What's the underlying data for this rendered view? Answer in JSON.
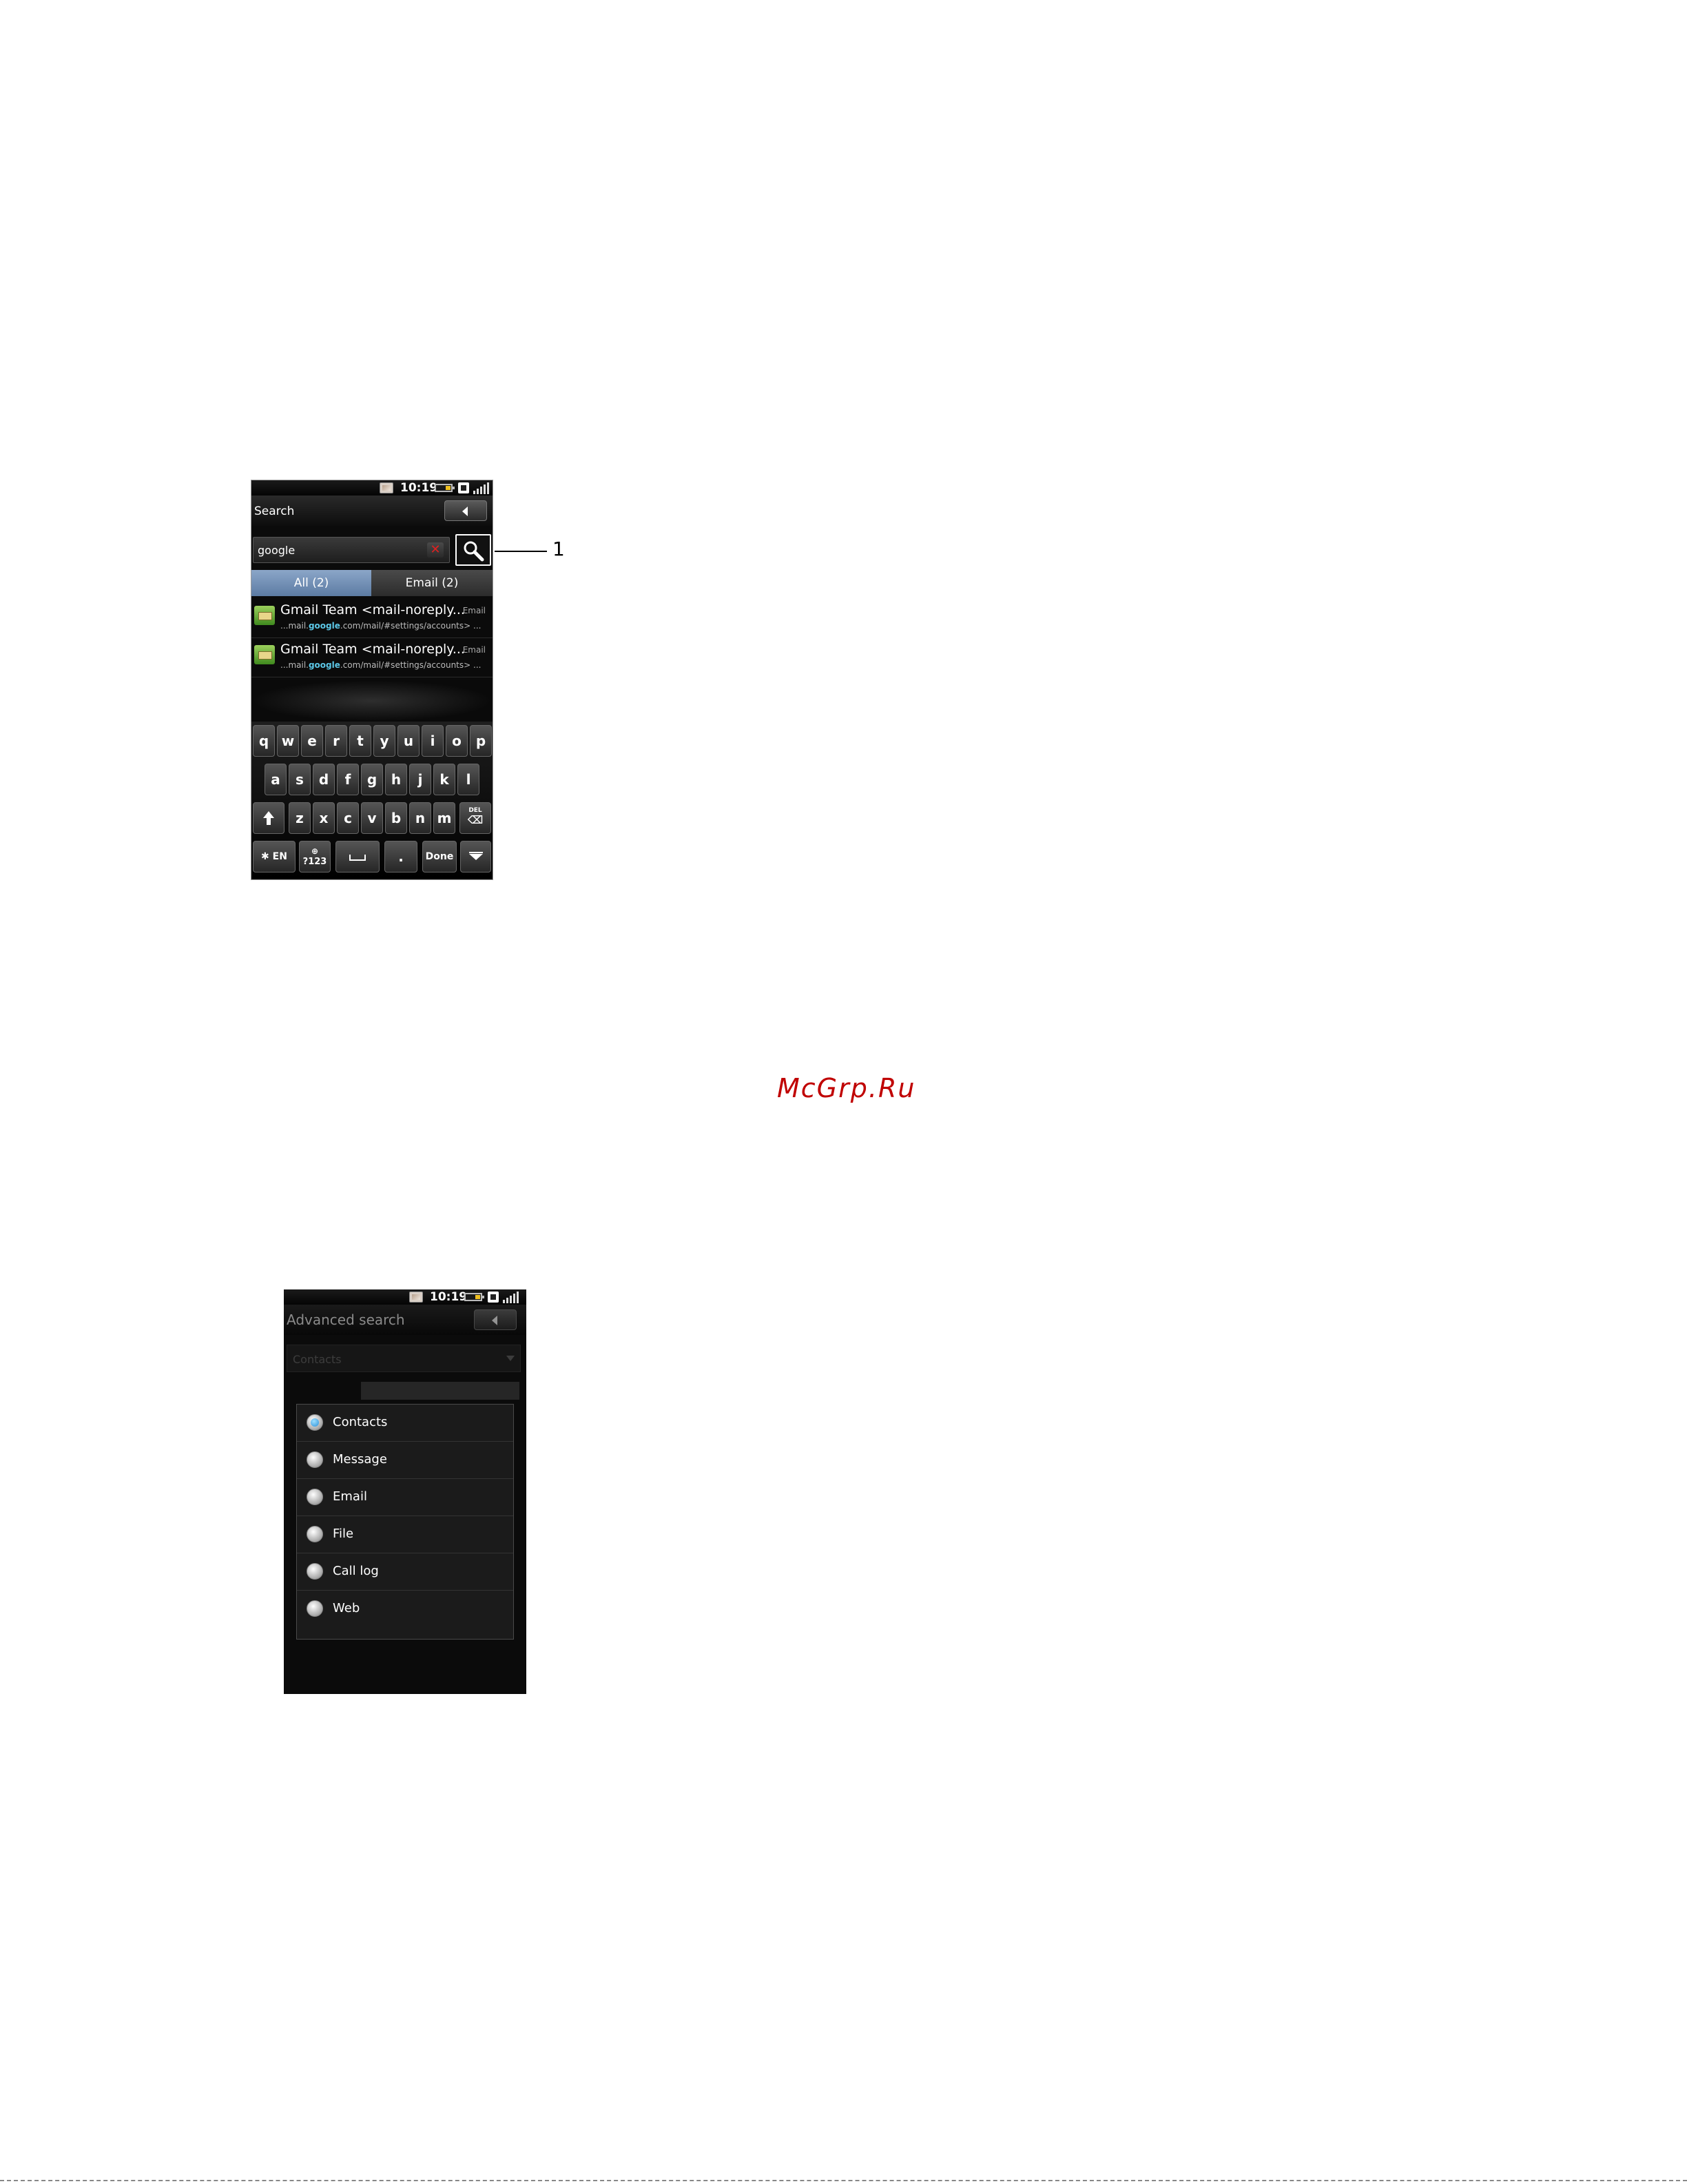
{
  "search_screen": {
    "status_bar": {
      "time": "10:19"
    },
    "title": "Search",
    "search": {
      "query": "google"
    },
    "tabs": [
      {
        "label": "All (2)",
        "active": true
      },
      {
        "label": "Email (2)",
        "active": false
      }
    ],
    "results": [
      {
        "title": "Gmail Team <mail-noreply...",
        "type": "Email",
        "snippet_prefix": "...mail.",
        "snippet_highlight": "google",
        "snippet_suffix": ".com/mail/#settings/accounts> ..."
      },
      {
        "title": "Gmail Team <mail-noreply...",
        "type": "Email",
        "snippet_prefix": "...mail.",
        "snippet_highlight": "google",
        "snippet_suffix": ".com/mail/#settings/accounts> ..."
      }
    ],
    "keyboard": {
      "row1": [
        "q",
        "w",
        "e",
        "r",
        "t",
        "y",
        "u",
        "i",
        "o",
        "p"
      ],
      "row2": [
        "a",
        "s",
        "d",
        "f",
        "g",
        "h",
        "j",
        "k",
        "l"
      ],
      "row3": [
        "z",
        "x",
        "c",
        "v",
        "b",
        "n",
        "m"
      ],
      "lang_label": "EN",
      "numbers_label": "?123",
      "period_label": ".",
      "done_label": "Done",
      "delete_label": "DEL"
    },
    "callout": "1"
  },
  "watermark": "McGrp.Ru",
  "advanced_screen": {
    "status_bar": {
      "time": "10:19"
    },
    "title": "Advanced search",
    "dim_combo_value": "Contacts",
    "options": [
      {
        "label": "Contacts",
        "selected": true
      },
      {
        "label": "Message",
        "selected": false
      },
      {
        "label": "Email",
        "selected": false
      },
      {
        "label": "File",
        "selected": false
      },
      {
        "label": "Call log",
        "selected": false
      },
      {
        "label": "Web",
        "selected": false
      }
    ]
  },
  "colors": {
    "watermark": "#c00000",
    "active_tab": "#6f8db5",
    "highlight": "#5cc8e8",
    "radio_selected": "#2a8fd8"
  }
}
